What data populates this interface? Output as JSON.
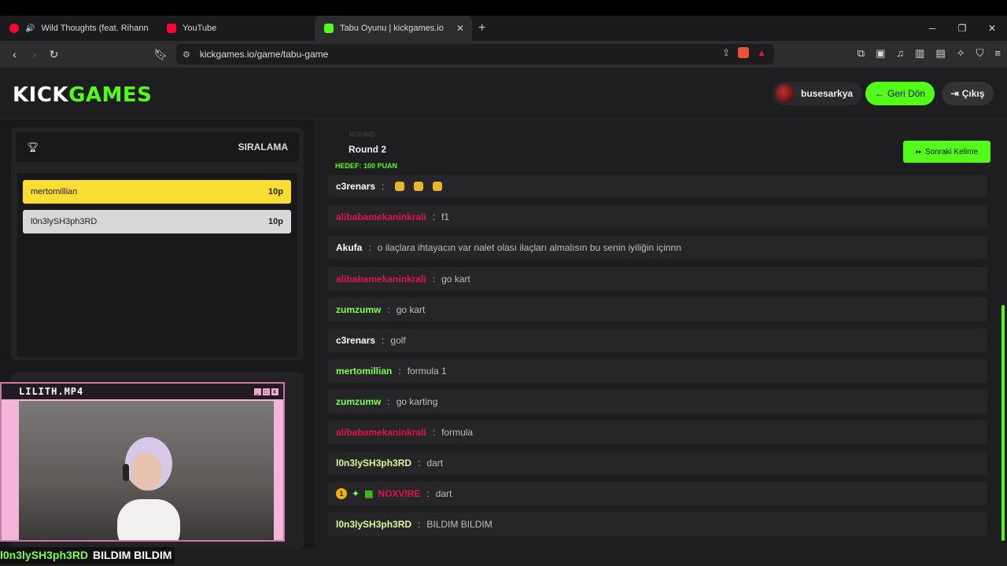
{
  "browser": {
    "tabs": [
      {
        "label": "Wild Thoughts (feat. Rihanna ve B",
        "favicon_color": "#ff0033",
        "active": false
      },
      {
        "label": "YouTube",
        "favicon_color": "#ff0033",
        "active": false
      },
      {
        "label": "Tabu Oyunu | kickgames.io",
        "favicon_color": "#53fc18",
        "active": true
      }
    ],
    "new_tab_icon": "+",
    "url": "kickgames.io/game/tabu-game"
  },
  "header": {
    "logo_part1": "KICK",
    "logo_part2": "GAMES",
    "username": "busesarkya",
    "back_label": "Geri Dön",
    "exit_label": "Çıkış",
    "accent": "#53fc18"
  },
  "ranking": {
    "title": "SIRALAMA",
    "rows": [
      {
        "name": "mertomillian",
        "points": "10p"
      },
      {
        "name": "l0n3lySH3ph3RD",
        "points": "10p"
      }
    ]
  },
  "webcam": {
    "title": "LILITH.MP4"
  },
  "game": {
    "round_faint": "ROUND",
    "round": "Round 2",
    "target": "HEDEF: 100 PUAN",
    "next_label": "Sonraki Kelime"
  },
  "chat": {
    "messages": [
      {
        "nick": "c3renars",
        "color": "#ffffff",
        "text": "",
        "emotes": 3
      },
      {
        "nick": "alibabamekaninkrali",
        "color": "#e0144c",
        "text": "f1"
      },
      {
        "nick": "Akufa",
        "color": "#ffffff",
        "text": "o ilaçlara ihtayacın var nalet olası ilaçları almalısın bu senin iyiliğin içinnn"
      },
      {
        "nick": "alibabamekaninkrali",
        "color": "#e0144c",
        "text": "go kart"
      },
      {
        "nick": "zumzumw",
        "color": "#7cff4d",
        "text": "go kart"
      },
      {
        "nick": "c3renars",
        "color": "#ffffff",
        "text": "golf"
      },
      {
        "nick": "mertomillian",
        "color": "#7cff4d",
        "text": "formula 1"
      },
      {
        "nick": "zumzumw",
        "color": "#7cff4d",
        "text": "go karting"
      },
      {
        "nick": "alibabamekaninkrali",
        "color": "#e0144c",
        "text": "formula"
      },
      {
        "nick": "l0n3lySH3ph3RD",
        "color": "#d9f99d",
        "text": "dart"
      },
      {
        "nick": "NOXVIRE",
        "color": "#e0144c",
        "text": "dart",
        "badges": [
          "1"
        ]
      },
      {
        "nick": "l0n3lySH3ph3RD",
        "color": "#d9f99d",
        "text": "BILDIM BILDIM"
      }
    ]
  },
  "stream_overlay": {
    "nick": "l0n3lySH3ph3RD",
    "text": "BILDIM BILDIM"
  }
}
